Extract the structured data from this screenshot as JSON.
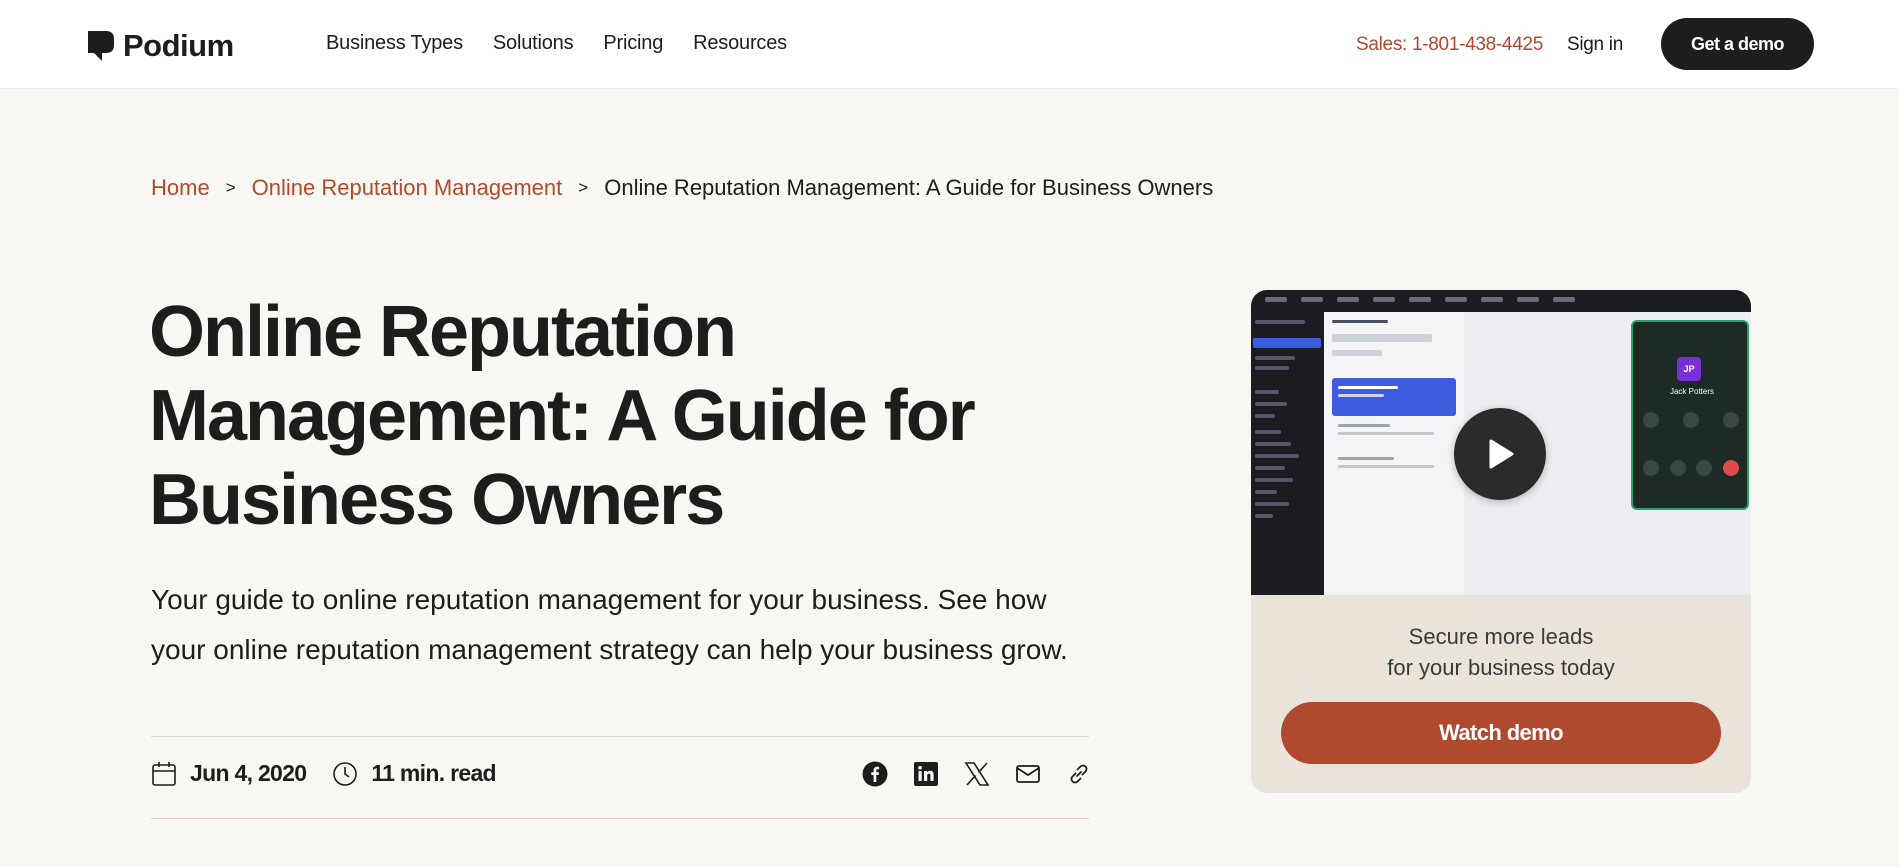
{
  "header": {
    "logo_text": "Podium",
    "nav": [
      "Business Types",
      "Solutions",
      "Pricing",
      "Resources"
    ],
    "sales_phone": "Sales: 1-801-438-4425",
    "signin_label": "Sign in",
    "demo_label": "Get a demo"
  },
  "breadcrumb": {
    "home": "Home",
    "sep": ">",
    "category": "Online Reputation Management",
    "current": "Online Reputation Management: A Guide for Business Owners"
  },
  "article": {
    "title": "Online Reputation Management: A Guide for Business Owners",
    "subtitle": "Your guide to online reputation management for your business. See how your online reputation management strategy can help your business grow.",
    "date": "Jun 4, 2020",
    "read_time": "11 min. read",
    "share_icons": [
      "facebook-icon",
      "linkedin-icon",
      "x-icon",
      "email-icon",
      "link-icon"
    ]
  },
  "card": {
    "caller_initials": "JP",
    "caller_name": "Jack Potters",
    "text_line1": "Secure more leads",
    "text_line2": "for your business today",
    "button_label": "Watch demo"
  },
  "colors": {
    "accent": "#b04a2f",
    "dark": "#1d1d1b",
    "background": "#f8f7f3",
    "card_bg": "#eae3da"
  }
}
